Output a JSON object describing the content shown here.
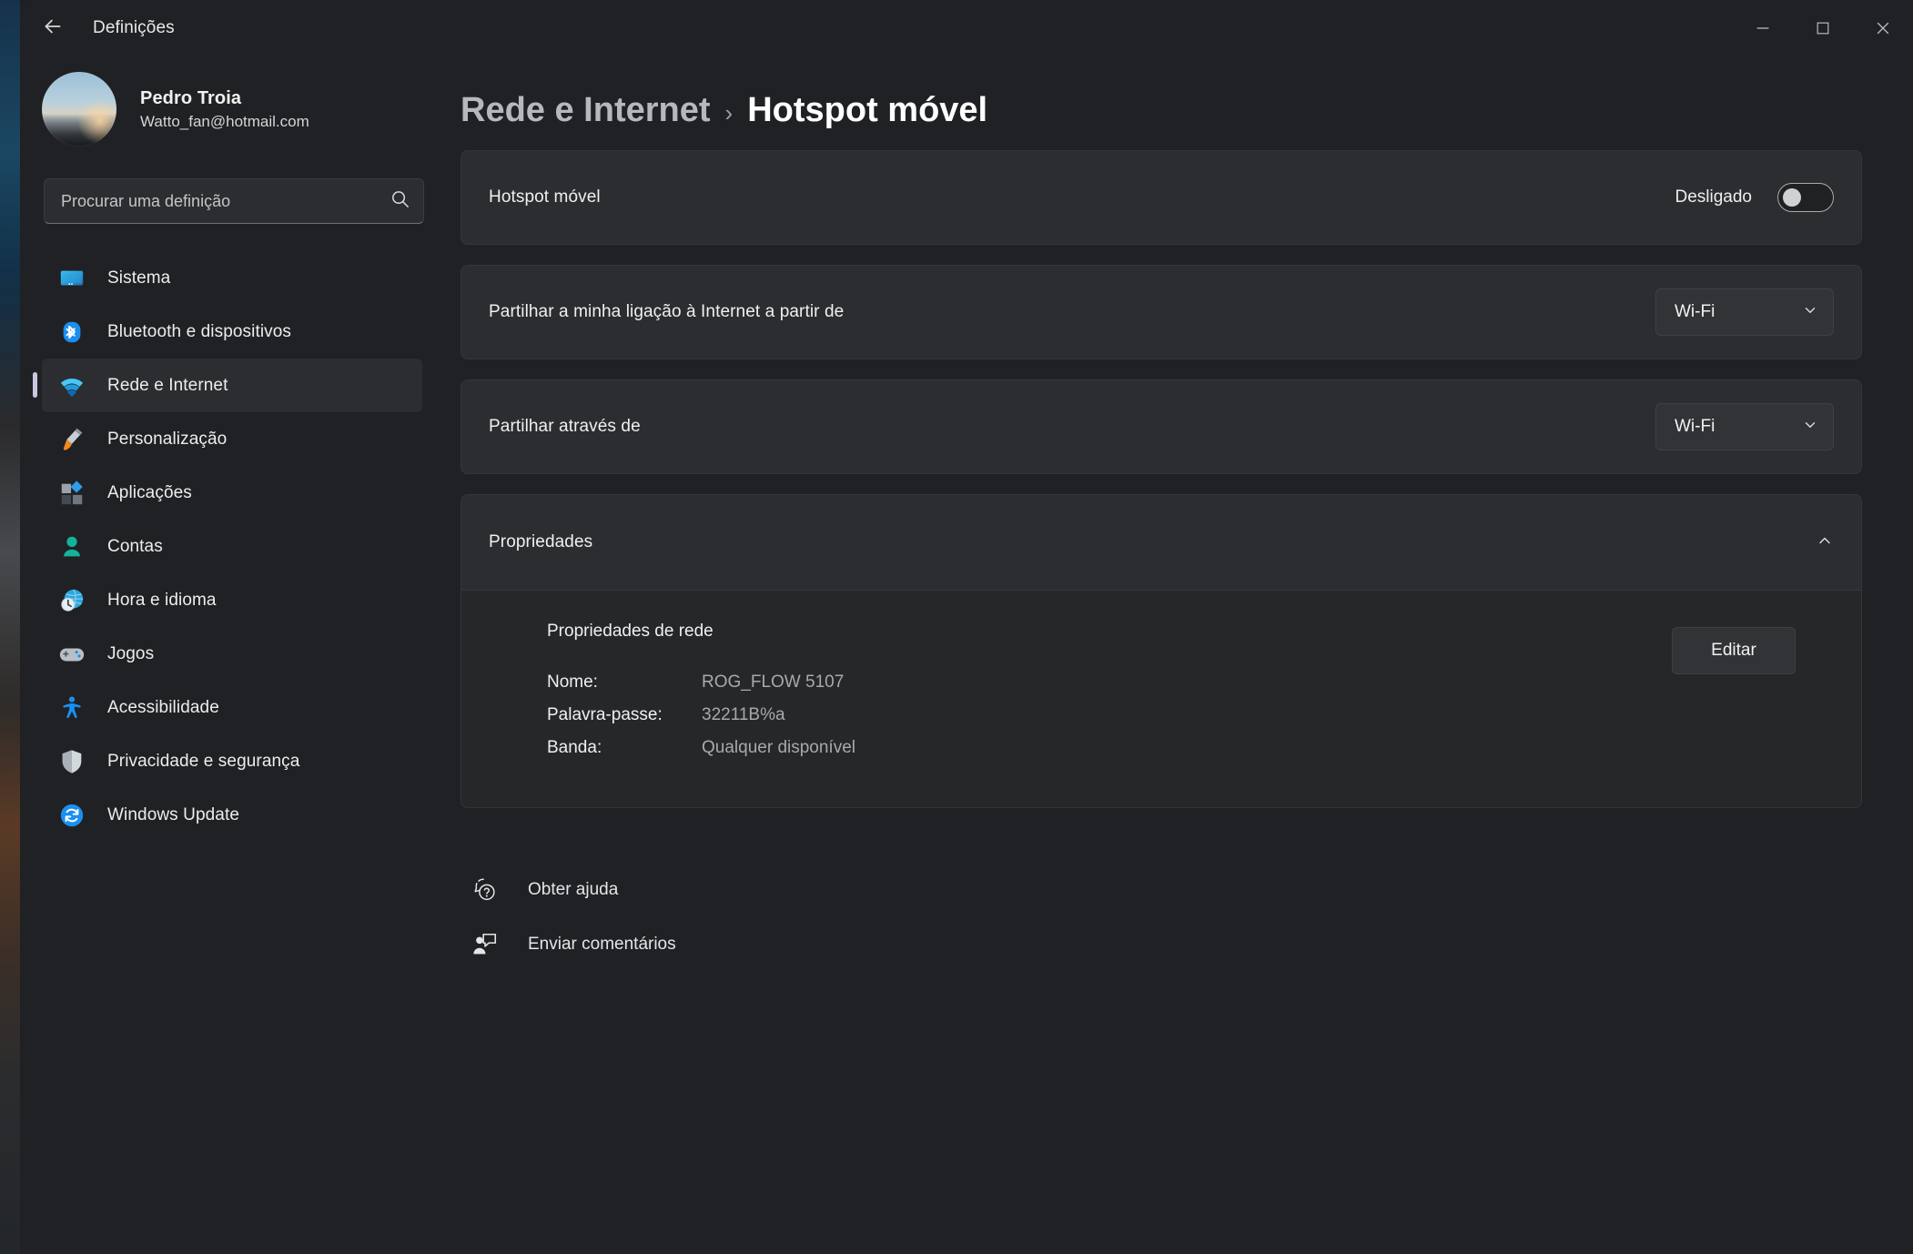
{
  "window": {
    "title": "Definições",
    "back_icon": "back-arrow-icon",
    "minimize_label": "—",
    "maximize_label": "□",
    "close_label": "✕"
  },
  "sidebar": {
    "profile": {
      "name": "Pedro Troia",
      "email": "Watto_fan@hotmail.com",
      "avatar_name": "user-avatar"
    },
    "search": {
      "placeholder": "Procurar uma definição",
      "value": "",
      "icon": "search-icon"
    },
    "items": [
      {
        "label": "Sistema",
        "icon": "monitor-icon",
        "active": false
      },
      {
        "label": "Bluetooth e dispositivos",
        "icon": "bluetooth-icon",
        "active": false
      },
      {
        "label": "Rede e Internet",
        "icon": "wifi-icon",
        "active": true
      },
      {
        "label": "Personalização",
        "icon": "paintbrush-icon",
        "active": false
      },
      {
        "label": "Aplicações",
        "icon": "apps-icon",
        "active": false
      },
      {
        "label": "Contas",
        "icon": "person-icon",
        "active": false
      },
      {
        "label": "Hora e idioma",
        "icon": "clock-globe-icon",
        "active": false
      },
      {
        "label": "Jogos",
        "icon": "gamepad-icon",
        "active": false
      },
      {
        "label": "Acessibilidade",
        "icon": "accessibility-icon",
        "active": false
      },
      {
        "label": "Privacidade e segurança",
        "icon": "shield-icon",
        "active": false
      },
      {
        "label": "Windows Update",
        "icon": "refresh-icon",
        "active": false
      }
    ]
  },
  "main": {
    "breadcrumb": {
      "parent": "Rede e Internet",
      "separator": "›",
      "current": "Hotspot móvel"
    },
    "hotspot_card": {
      "label": "Hotspot móvel",
      "state_label": "Desligado",
      "toggle_on": false
    },
    "share_from_card": {
      "label": "Partilhar a minha ligação à Internet a partir de",
      "value": "Wi-Fi"
    },
    "share_over_card": {
      "label": "Partilhar através de",
      "value": "Wi-Fi"
    },
    "properties": {
      "header": "Propriedades",
      "expanded": true,
      "chevron_icon": "chevron-up-icon",
      "subtitle": "Propriedades de rede",
      "edit_label": "Editar",
      "rows": [
        {
          "key": "Nome:",
          "value": "ROG_FLOW 5107"
        },
        {
          "key": "Palavra-passe:",
          "value": "32211B%a"
        },
        {
          "key": "Banda:",
          "value": "Qualquer disponível"
        }
      ]
    },
    "footer_links": [
      {
        "label": "Obter ajuda",
        "icon": "help-bubble-icon"
      },
      {
        "label": "Enviar comentários",
        "icon": "feedback-person-icon"
      }
    ]
  },
  "colors": {
    "window_bg": "#202124",
    "card_bg": "#2b2d30",
    "accent_selection": "#c6c8e0",
    "text_primary": "#f0f0f0",
    "text_secondary": "#a7aaac"
  }
}
